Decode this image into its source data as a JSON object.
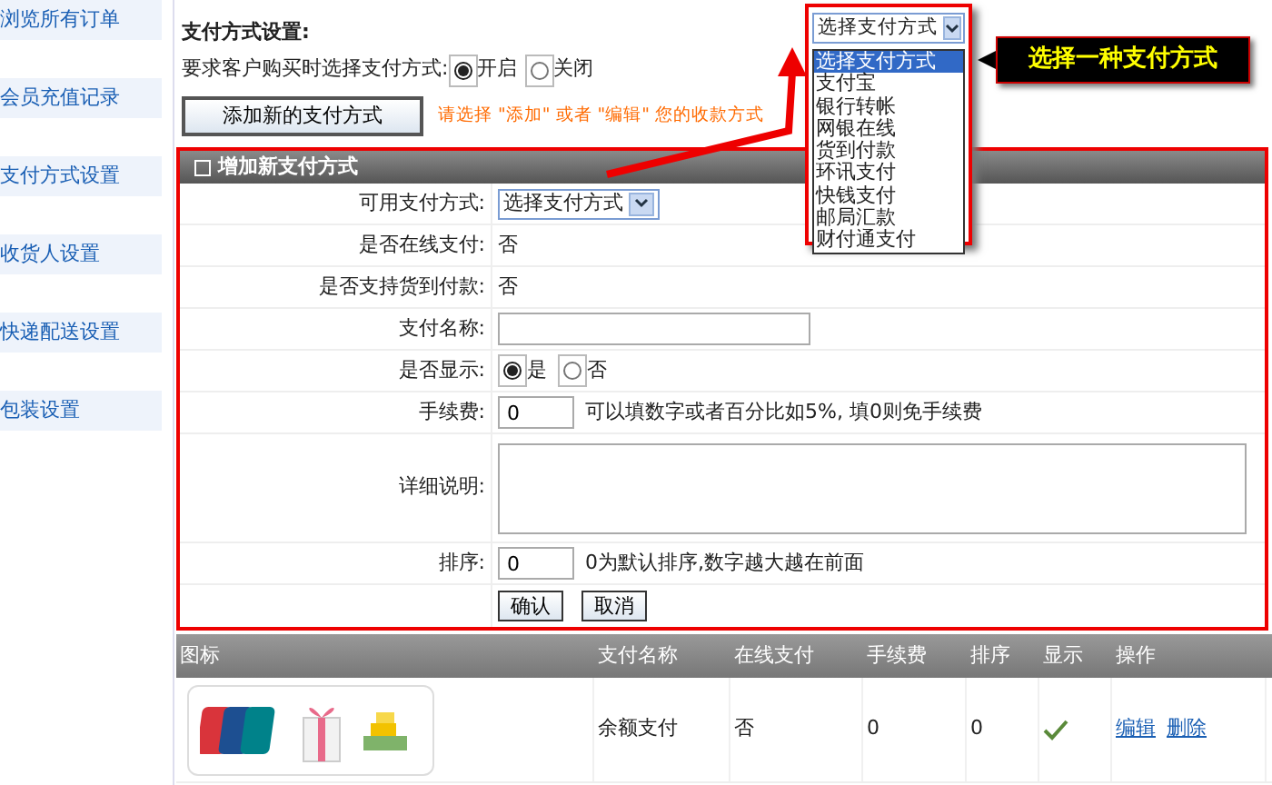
{
  "sidebar": {
    "items": [
      {
        "label": "浏览所有订单"
      },
      {
        "label": "会员充值记录"
      },
      {
        "label": "支付方式设置"
      },
      {
        "label": "收货人设置"
      },
      {
        "label": "快递配送设置"
      },
      {
        "label": "包装设置"
      }
    ]
  },
  "settings": {
    "title": "支付方式设置:",
    "require_label": "要求客户购买时选择支付方式:",
    "options": [
      {
        "label": "开启",
        "selected": true
      },
      {
        "label": "关闭",
        "selected": false
      }
    ],
    "add_button": "添加新的支付方式",
    "hint": "请选择 \"添加\" 或者 \"编辑\" 您的收款方式"
  },
  "dropdown": {
    "value": "选择支付方式",
    "options": [
      {
        "label": "选择支付方式",
        "selected": true
      },
      {
        "label": "支付宝",
        "selected": false
      },
      {
        "label": "银行转帐",
        "selected": false
      },
      {
        "label": "网银在线",
        "selected": false
      },
      {
        "label": "货到付款",
        "selected": false
      },
      {
        "label": "环讯支付",
        "selected": false
      },
      {
        "label": "快钱支付",
        "selected": false
      },
      {
        "label": "邮局汇款",
        "selected": false
      },
      {
        "label": "财付通支付",
        "selected": false
      }
    ]
  },
  "callout": "选择一种支付方式",
  "form": {
    "title": "增加新支付方式",
    "fields": [
      {
        "kind": "select",
        "label": "可用支付方式:",
        "value": "选择支付方式"
      },
      {
        "kind": "text",
        "label": "是否在线支付:",
        "value": "否"
      },
      {
        "kind": "text",
        "label": "是否支持货到付款:",
        "value": "否"
      },
      {
        "kind": "input",
        "label": "支付名称:"
      },
      {
        "kind": "radio",
        "label": "是否显示:",
        "options": [
          {
            "label": "是",
            "selected": true
          },
          {
            "label": "否",
            "selected": false
          }
        ]
      },
      {
        "kind": "input_hint",
        "label": "手续费:",
        "value": "0",
        "hint": "可以填数字或者百分比如5%, 填0则免手续费"
      },
      {
        "kind": "textarea",
        "label": "详细说明:"
      },
      {
        "kind": "input_hint",
        "label": "排序:",
        "value": "0",
        "hint": "0为默认排序,数字越大越在前面"
      }
    ],
    "buttons": [
      "确认",
      "取消"
    ]
  },
  "table": {
    "columns": [
      "图标",
      "支付名称",
      "在线支付",
      "手续费",
      "排序",
      "显示",
      "操作"
    ],
    "rows": [
      {
        "name": "余额支付",
        "online": "否",
        "fee": "0",
        "order": "0",
        "shown": true,
        "actions": [
          "编辑",
          "删除"
        ]
      }
    ]
  }
}
